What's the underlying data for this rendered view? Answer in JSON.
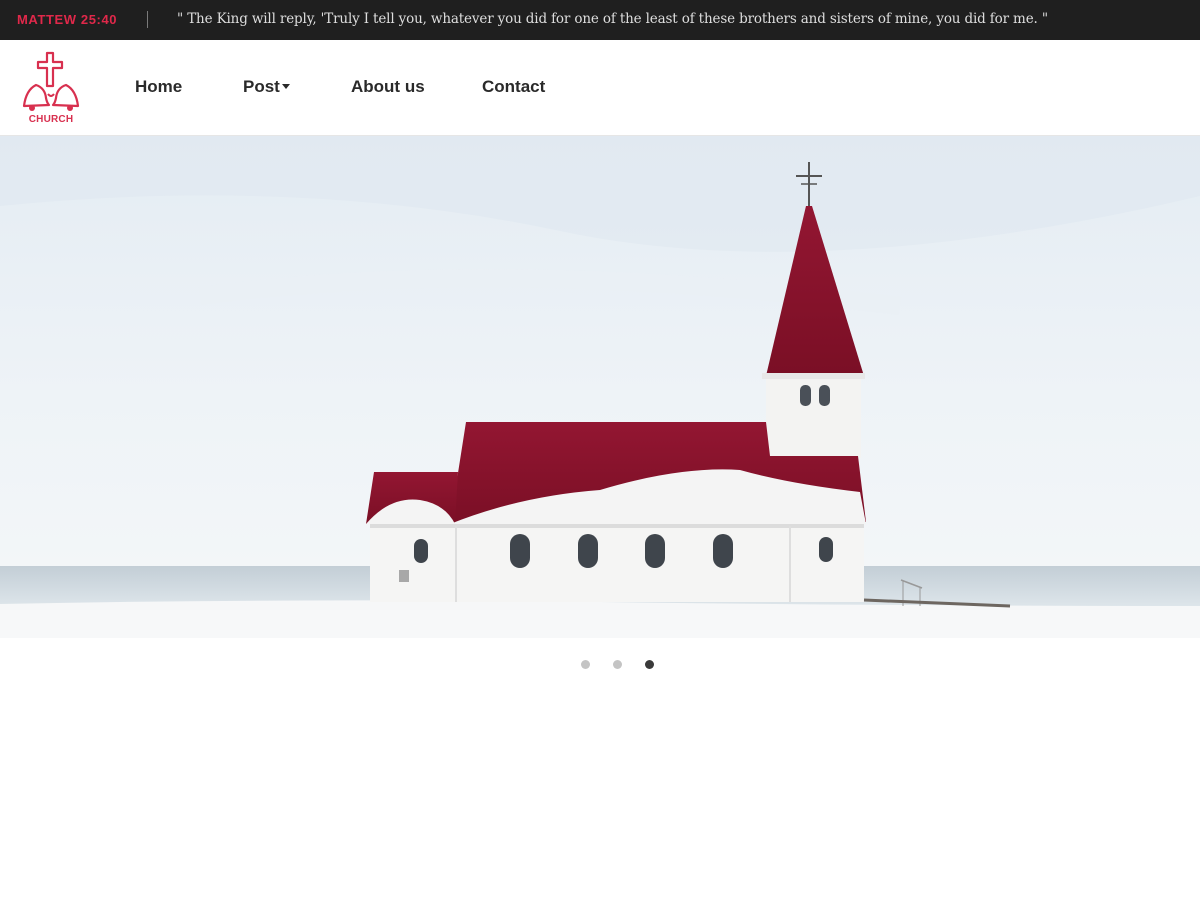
{
  "verse": {
    "reference": "MATTEW 25:40",
    "quote": "\" The King will reply, 'Truly I tell you, whatever you did for one of the least of these brothers and sisters of mine, you did for me. \""
  },
  "logo": {
    "text": "CHURCH",
    "icon": "cross-bells-icon",
    "color": "#d8304f"
  },
  "nav": {
    "items": [
      {
        "label": "Home"
      },
      {
        "label": "Post",
        "has_dropdown": true
      },
      {
        "label": "About us"
      },
      {
        "label": "Contact"
      }
    ]
  },
  "slider": {
    "slide_count": 3,
    "active_slide": 3,
    "image": "white-church-red-roof-snow"
  },
  "colors": {
    "accent": "#e0284a",
    "top_bar": "#1f1f1f",
    "roof": "#8e1128"
  }
}
